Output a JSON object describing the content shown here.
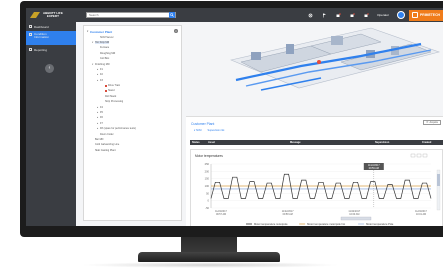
{
  "app": {
    "logo_text": "ABBOTT LIFE\nEXPERT",
    "search_placeholder": "Search",
    "operator_label": "Operator",
    "brand_text": "PRIMETECH"
  },
  "nav": {
    "items": [
      {
        "label": "Dashboard",
        "active": false
      },
      {
        "label": "Condition\nInformation",
        "active": true
      },
      {
        "label": "Reporting",
        "active": false
      }
    ],
    "collapse_symbol": "‹"
  },
  "tree": {
    "root": "Customer Plant",
    "rows": [
      {
        "label": "SCM Server",
        "indent": 2,
        "caret": "",
        "dot": false
      },
      {
        "label": "Hot Strip Mill",
        "indent": 1,
        "caret": "▾",
        "dot": false,
        "selected": true
      },
      {
        "label": "Furnace",
        "indent": 2,
        "caret": "",
        "dot": false
      },
      {
        "label": "Roughing Mill",
        "indent": 2,
        "caret": "",
        "dot": false
      },
      {
        "label": "Coil Box",
        "indent": 2,
        "caret": "",
        "dot": false
      },
      {
        "label": "Finishing Mill",
        "indent": 1,
        "caret": "▾",
        "dot": false
      },
      {
        "label": "F1",
        "indent": 2,
        "caret": "▸",
        "dot": false
      },
      {
        "label": "F2",
        "indent": 2,
        "caret": "▸",
        "dot": false
      },
      {
        "label": "F3",
        "indent": 2,
        "caret": "▸",
        "dot": false
      },
      {
        "label": "Drive Train",
        "indent": 3,
        "caret": "",
        "dot": true
      },
      {
        "label": "Stand",
        "indent": 3,
        "caret": "",
        "dot": true
      },
      {
        "label": "Roll Stack",
        "indent": 3,
        "caret": "",
        "dot": false
      },
      {
        "label": "Strip Processing",
        "indent": 3,
        "caret": "",
        "dot": false
      },
      {
        "label": "F4",
        "indent": 2,
        "caret": "▸",
        "dot": false
      },
      {
        "label": "F5",
        "indent": 2,
        "caret": "▸",
        "dot": false
      },
      {
        "label": "F6",
        "indent": 2,
        "caret": "▸",
        "dot": false
      },
      {
        "label": "F7",
        "indent": 2,
        "caret": "▸",
        "dot": false
      },
      {
        "label": "F8 (spare for performance tests)",
        "indent": 2,
        "caret": "▸",
        "dot": false
      },
      {
        "label": "Down Coiler",
        "indent": 2,
        "caret": "",
        "dot": false
      },
      {
        "label": "Bar Mill",
        "indent": 1,
        "caret": "",
        "dot": false
      },
      {
        "label": "Cold Galvanizing Line",
        "indent": 1,
        "caret": "",
        "dot": false
      },
      {
        "label": "Slab Casting Plant",
        "indent": 1,
        "caret": "",
        "dot": false
      }
    ]
  },
  "detail": {
    "title": "Customer Plant",
    "sub_items": [
      "SCM",
      "Supervision list"
    ],
    "button_label": "Acquire",
    "columns": [
      "Status",
      "Asset",
      "Message",
      "Supervision",
      "Created"
    ]
  },
  "chart_data": {
    "type": "line",
    "title": "Motor temperatures",
    "y_ticks": [
      "250",
      "200",
      "150",
      "100",
      "50",
      "0",
      "-50"
    ],
    "ylim": [
      -50,
      250
    ],
    "x_ticks": [
      "11/22/2017\n09:57 AM",
      "11/22/2017\n09:58 AM",
      "11/22/2017\n10:00 AM",
      "11/22/2017\n10:01 AM"
    ],
    "tooltip_text": "11/22/2017\n09:59 AM",
    "legend": [
      "Motor temperature motorpole",
      "Motor temperature motorpole hot",
      "Motor temperature Pole"
    ],
    "series": [
      {
        "name": "Motor temperature motorpole",
        "color": "#333333",
        "values": [
          15,
          125,
          125,
          15,
          15,
          160,
          160,
          15,
          15,
          130,
          130,
          15,
          15,
          120,
          120,
          15,
          15,
          180,
          180,
          15,
          15,
          140,
          140,
          15,
          15,
          125,
          125,
          15,
          15,
          120,
          120,
          15,
          15,
          125,
          125,
          15,
          15,
          130,
          130,
          15,
          15,
          110,
          110,
          15,
          15,
          140,
          140,
          15,
          15,
          120,
          120,
          15
        ]
      },
      {
        "name": "Motor temperature motorpole hot",
        "color": "#d9a24b",
        "values": [
          100,
          100
        ]
      },
      {
        "name": "Motor temperature Pole",
        "color": "#9fb7e0",
        "values": [
          80,
          80
        ]
      }
    ],
    "colors": {
      "accent": "#2f80ed",
      "brand": "#f07c1a",
      "nav": "#3a3d42"
    }
  }
}
